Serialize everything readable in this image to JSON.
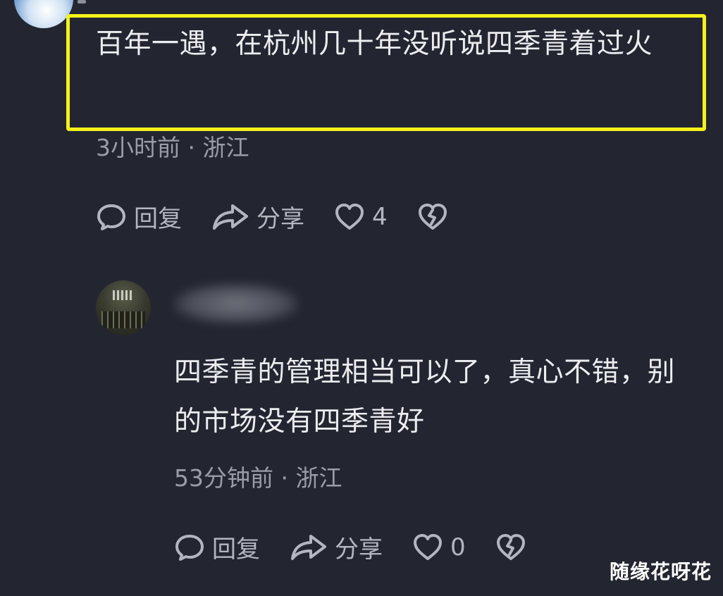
{
  "comment1": {
    "text": "百年一遇，在杭州几十年没听说四季青着过火",
    "meta": "3小时前 · 浙江",
    "actions": {
      "reply_label": "回复",
      "share_label": "分享",
      "like_count": "4"
    }
  },
  "comment2": {
    "text": "四季青的管理相当可以了，真心不错，别的市场没有四季青好",
    "meta": "53分钟前 · 浙江",
    "actions": {
      "reply_label": "回复",
      "share_label": "分享",
      "like_count": "0"
    }
  },
  "watermark": "随缘花呀花",
  "colors": {
    "background": "#232631",
    "highlight": "#f4f21a",
    "text": "#ecedf1",
    "meta": "#9a9ca6",
    "icon": "#b4b6bf"
  },
  "icons": {
    "reply": "comment-bubble-icon",
    "share": "share-arrow-icon",
    "like": "heart-icon",
    "dislike": "broken-heart-icon"
  }
}
